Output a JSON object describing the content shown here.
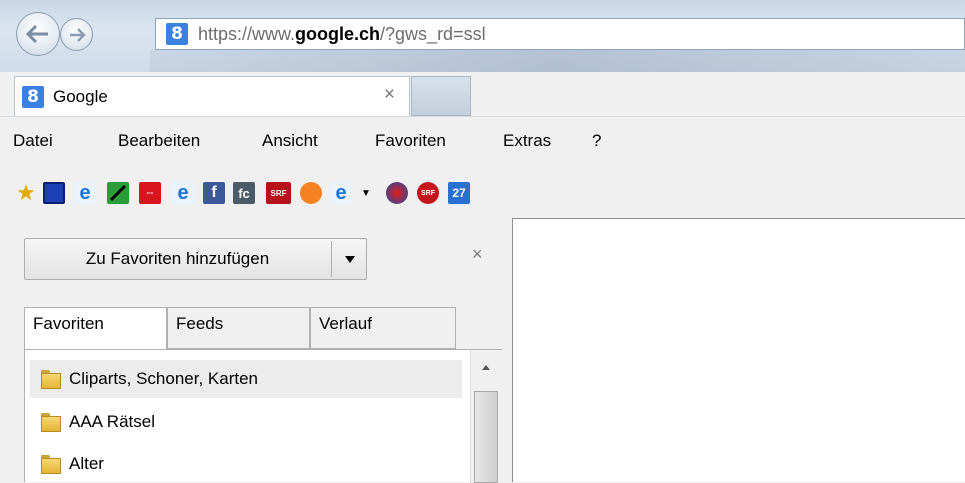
{
  "browser": {
    "address": {
      "scheme_prefix": "https://www.",
      "domain": "google.ch",
      "rest": "/?gws_rd=ssl"
    },
    "favicon_letter": "8",
    "tab": {
      "title": "Google",
      "close_glyph": "×"
    }
  },
  "menu": [
    "Datei",
    "Bearbeiten",
    "Ansicht",
    "Favoriten",
    "Extras",
    "?"
  ],
  "favorites_bar": {
    "icons": [
      "add-to-favorites-icon",
      "monitor-icon",
      "ie-icon",
      "feather-icon",
      "sbb-icon",
      "ie-icon",
      "facebook-icon",
      "fc-icon",
      "srf-icon",
      "orange-icon",
      "ie-dropdown-icon",
      "swisscom-icon",
      "srf-round-icon",
      "calendar-icon"
    ],
    "srf_label": "SRF",
    "fc_label": "fc",
    "fb_label": "f",
    "calendar_label": "27"
  },
  "favorites_pane": {
    "add_button_label": "Zu Favoriten hinzufügen",
    "close_glyph": "×",
    "tabs": [
      "Favoriten",
      "Feeds",
      "Verlauf"
    ],
    "items": [
      "Cliparts, Schoner, Karten",
      "AAA Rätsel",
      "Alter"
    ]
  }
}
